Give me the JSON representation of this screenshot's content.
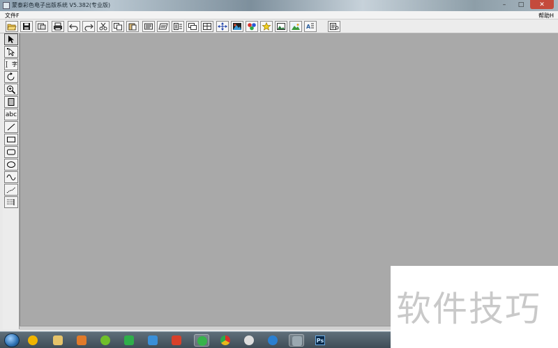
{
  "window": {
    "title": "蒙泰彩色电子出版系统 V5.382(专业版)",
    "controls": {
      "minimize": "–",
      "maximize": "□",
      "close": "✕"
    }
  },
  "menubar": {
    "file": "文件F",
    "help": "帮助H"
  },
  "toolbar": {
    "buttons": [
      {
        "name": "open-button",
        "icon": "folder-open-icon",
        "color": "#d9a63a"
      },
      {
        "name": "save-button",
        "icon": "floppy-disk-icon",
        "color": "#1a1a1a"
      },
      {
        "name": "import-button",
        "icon": "import-icon",
        "color": "#333333"
      },
      {
        "name": "print-button",
        "icon": "printer-icon",
        "color": "#222222"
      },
      {
        "name": "undo-button",
        "icon": "undo-icon",
        "color": "#333333"
      },
      {
        "name": "redo-button",
        "icon": "redo-icon",
        "color": "#333333"
      },
      {
        "name": "cut-button",
        "icon": "scissors-icon",
        "color": "#333333"
      },
      {
        "name": "copy-button",
        "icon": "copy-icon",
        "color": "#333333"
      },
      {
        "name": "paste-button",
        "icon": "paste-icon",
        "color": "#333333"
      },
      {
        "name": "page-setup-button",
        "icon": "page-frame-icon",
        "color": "#333333"
      },
      {
        "name": "page-skew-button",
        "icon": "page-skew-icon",
        "color": "#333333"
      },
      {
        "name": "text-flow-button",
        "icon": "text-flow-icon",
        "color": "#333333"
      },
      {
        "name": "layer-button",
        "icon": "layers-icon",
        "color": "#333333"
      },
      {
        "name": "table-button",
        "icon": "table-icon",
        "color": "#333333"
      },
      {
        "name": "move-button",
        "icon": "move-arrows-icon",
        "color": "#2244aa"
      },
      {
        "name": "image-color-button",
        "icon": "color-image-icon",
        "color": "#c0392b"
      },
      {
        "name": "color-palette-button",
        "icon": "color-balls-icon",
        "color": "#27ae60"
      },
      {
        "name": "star-shape-button",
        "icon": "star-icon",
        "color": "#e8c21c"
      },
      {
        "name": "picture-button",
        "icon": "picture-frame-icon",
        "color": "#2d7a3e"
      },
      {
        "name": "landscape-button",
        "icon": "landscape-icon",
        "color": "#3a9a3a"
      },
      {
        "name": "text-effect-button",
        "icon": "text-effect-icon",
        "color": "#2b5f9e"
      },
      {
        "name": "preview-button",
        "icon": "preview-icon",
        "color": "#333333"
      }
    ]
  },
  "toolbox": {
    "tools": [
      {
        "name": "select-tool",
        "icon": "arrow-pointer-icon",
        "label": ""
      },
      {
        "name": "node-select-tool",
        "icon": "node-pointer-icon",
        "label": ""
      },
      {
        "name": "text-tool",
        "icon": "text-cursor-icon",
        "label": "字"
      },
      {
        "name": "rotate-tool",
        "icon": "rotate-icon",
        "label": ""
      },
      {
        "name": "zoom-tool",
        "icon": "magnifier-icon",
        "label": ""
      },
      {
        "name": "frame-tool",
        "icon": "frame-icon",
        "label": ""
      },
      {
        "name": "abc-text-tool",
        "icon": "abc-icon",
        "label": "abc"
      },
      {
        "name": "line-tool",
        "icon": "diagonal-line-icon",
        "label": ""
      },
      {
        "name": "rectangle-tool",
        "icon": "rectangle-icon",
        "label": ""
      },
      {
        "name": "rounded-rect-tool",
        "icon": "rounded-rectangle-icon",
        "label": ""
      },
      {
        "name": "ellipse-tool",
        "icon": "ellipse-icon",
        "label": ""
      },
      {
        "name": "curve-tool",
        "icon": "wave-curve-icon",
        "label": ""
      },
      {
        "name": "polyline-tool",
        "icon": "polyline-icon",
        "label": ""
      },
      {
        "name": "table-tool",
        "icon": "table-grid-icon",
        "label": ""
      }
    ]
  },
  "taskbar": {
    "apps": [
      {
        "name": "taskbar-app-360",
        "icon": "app-360-icon",
        "color": "#f0b400"
      },
      {
        "name": "taskbar-explorer",
        "icon": "folder-icon",
        "color": "#e6c36a"
      },
      {
        "name": "taskbar-media-player",
        "icon": "media-player-icon",
        "color": "#e07a2a"
      },
      {
        "name": "taskbar-360-safe",
        "icon": "green-ball-icon",
        "color": "#6fbf2a"
      },
      {
        "name": "taskbar-shield",
        "icon": "shield-icon",
        "color": "#2fae4a"
      },
      {
        "name": "taskbar-cloud",
        "icon": "cloud-icon",
        "color": "#3a8fd8"
      },
      {
        "name": "taskbar-tiles",
        "icon": "tiles-icon",
        "color": "#d8402a"
      },
      {
        "name": "taskbar-green-app",
        "icon": "green-circle-icon",
        "color": "#36b34a"
      },
      {
        "name": "taskbar-chrome",
        "icon": "chrome-icon",
        "color": "#e8b81a"
      },
      {
        "name": "taskbar-film",
        "icon": "film-reel-icon",
        "color": "#dddddd"
      },
      {
        "name": "taskbar-cloud2",
        "icon": "cloud-blue-icon",
        "color": "#2a7fd0"
      },
      {
        "name": "taskbar-founder",
        "icon": "founder-app-icon",
        "color": "#9aa8b0"
      },
      {
        "name": "taskbar-photoshop",
        "icon": "photoshop-icon",
        "color": "#0b2a4a"
      }
    ],
    "ps_label": "Ps"
  },
  "watermark": {
    "text": "软件技巧"
  }
}
